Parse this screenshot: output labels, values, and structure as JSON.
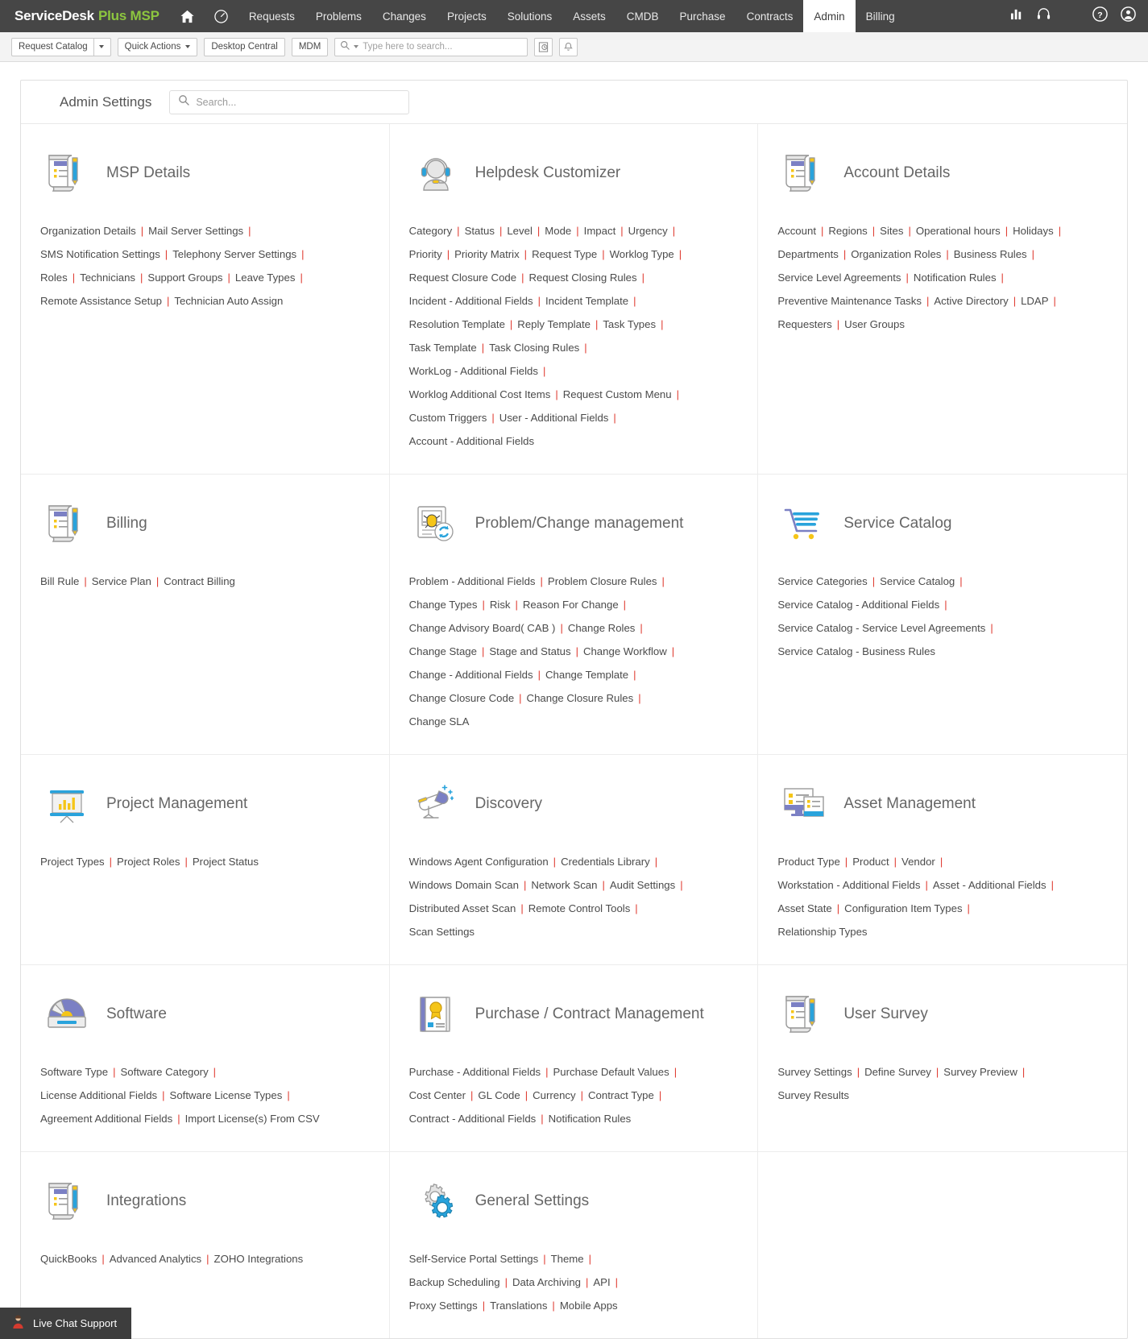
{
  "topnav": {
    "brand": {
      "part1": "ServiceDesk",
      "part2": "Plus MSP"
    },
    "home_icon": "home-icon",
    "dashboard_icon": "dashboard-icon",
    "items": [
      {
        "label": "Requests",
        "active": false
      },
      {
        "label": "Problems",
        "active": false
      },
      {
        "label": "Changes",
        "active": false
      },
      {
        "label": "Projects",
        "active": false
      },
      {
        "label": "Solutions",
        "active": false
      },
      {
        "label": "Assets",
        "active": false
      },
      {
        "label": "CMDB",
        "active": false
      },
      {
        "label": "Purchase",
        "active": false
      },
      {
        "label": "Contracts",
        "active": false
      },
      {
        "label": "Admin",
        "active": true
      },
      {
        "label": "Billing",
        "active": false
      }
    ],
    "reports_icon": "bar-chart-icon",
    "support_icon": "headset-icon",
    "help_icon": "question-circle-icon",
    "profile_icon": "user-circle-icon"
  },
  "toolbar": {
    "request_catalog": "Request Catalog",
    "quick_actions": "Quick Actions",
    "desktop_central": "Desktop Central",
    "mdm": "MDM",
    "search_placeholder": "Type here to search...",
    "search_value": "",
    "history_icon": "recent-history-icon",
    "alert_icon": "bell-icon"
  },
  "panel": {
    "title": "Admin Settings",
    "search_placeholder": "Search...",
    "search_value": "",
    "search_icon": "search-icon"
  },
  "sections": [
    {
      "id": "msp-details",
      "title": "MSP Details",
      "icon": "scroll-pen-icon",
      "links": [
        "Organization Details",
        "Mail Server Settings",
        "SMS Notification Settings",
        "Telephony Server Settings",
        "Roles",
        "Technicians",
        "Support Groups",
        "Leave Types",
        "Remote Assistance Setup",
        "Technician Auto Assign"
      ],
      "breaks": [
        2,
        4,
        8
      ]
    },
    {
      "id": "helpdesk-customizer",
      "title": "Helpdesk Customizer",
      "icon": "headset-person-icon",
      "links": [
        "Category",
        "Status",
        "Level",
        "Mode",
        "Impact",
        "Urgency",
        "Priority",
        "Priority Matrix",
        "Request Type",
        "Worklog Type",
        "Request Closure Code",
        "Request Closing Rules",
        "Incident - Additional Fields",
        "Incident Template",
        "Resolution Template",
        "Reply Template",
        "Task Types",
        "Task Template",
        "Task Closing Rules",
        "WorkLog - Additional Fields",
        "Worklog Additional Cost Items",
        "Request Custom Menu",
        "Custom Triggers",
        "User - Additional Fields",
        "Account - Additional Fields"
      ],
      "breaks": [
        6,
        10,
        12,
        14,
        17,
        19,
        20,
        22,
        24
      ]
    },
    {
      "id": "account-details",
      "title": "Account Details",
      "icon": "scroll-pen-icon",
      "links": [
        "Account",
        "Regions",
        "Sites",
        "Operational hours",
        "Holidays",
        "Departments",
        "Organization Roles",
        "Business Rules",
        "Service Level Agreements",
        "Notification Rules",
        "Preventive Maintenance Tasks",
        "Active Directory",
        "LDAP",
        "Requesters",
        "User Groups"
      ],
      "breaks": [
        5,
        8,
        10,
        13
      ]
    },
    {
      "id": "billing",
      "title": "Billing",
      "icon": "scroll-pen-icon",
      "links": [
        "Bill Rule",
        "Service Plan",
        "Contract Billing"
      ],
      "breaks": []
    },
    {
      "id": "problem-change-management",
      "title": "Problem/Change management",
      "icon": "bug-refresh-icon",
      "links": [
        "Problem - Additional Fields",
        "Problem Closure Rules",
        "Change Types",
        "Risk",
        "Reason For Change",
        "Change Advisory Board( CAB )",
        "Change Roles",
        "Change Stage",
        "Stage and Status",
        "Change Workflow",
        "Change - Additional Fields",
        "Change Template",
        "Change Closure Code",
        "Change Closure Rules",
        "Change SLA"
      ],
      "breaks": [
        2,
        5,
        7,
        10,
        12,
        14
      ]
    },
    {
      "id": "service-catalog",
      "title": "Service Catalog",
      "icon": "shopping-cart-icon",
      "links": [
        "Service Categories",
        "Service Catalog",
        "Service Catalog - Additional Fields",
        "Service Catalog - Service Level Agreements",
        "Service Catalog - Business Rules"
      ],
      "breaks": [
        2,
        3,
        4
      ]
    },
    {
      "id": "project-management",
      "title": "Project Management",
      "icon": "presentation-chart-icon",
      "links": [
        "Project Types",
        "Project Roles",
        "Project Status"
      ],
      "breaks": []
    },
    {
      "id": "discovery",
      "title": "Discovery",
      "icon": "telescope-icon",
      "links": [
        "Windows Agent Configuration",
        "Credentials Library",
        "Windows Domain Scan",
        "Network Scan",
        "Audit Settings",
        "Distributed Asset Scan",
        "Remote Control Tools",
        "Scan Settings"
      ],
      "breaks": [
        2,
        5,
        7
      ]
    },
    {
      "id": "asset-management",
      "title": "Asset Management",
      "icon": "monitor-devices-icon",
      "links": [
        "Product Type",
        "Product",
        "Vendor",
        "Workstation - Additional Fields",
        "Asset - Additional Fields",
        "Asset State",
        "Configuration Item Types",
        "Relationship Types"
      ],
      "breaks": [
        3,
        5,
        7
      ]
    },
    {
      "id": "software",
      "title": "Software",
      "icon": "cd-disc-icon",
      "links": [
        "Software Type",
        "Software Category",
        "License Additional Fields",
        "Software License Types",
        "Agreement Additional Fields",
        "Import License(s) From CSV"
      ],
      "breaks": [
        2,
        4
      ]
    },
    {
      "id": "purchase-contract-management",
      "title": "Purchase / Contract Management",
      "icon": "certificate-book-icon",
      "links": [
        "Purchase - Additional Fields",
        "Purchase Default Values",
        "Cost Center",
        "GL Code",
        "Currency",
        "Contract Type",
        "Contract - Additional Fields",
        "Notification Rules"
      ],
      "breaks": [
        2,
        6
      ]
    },
    {
      "id": "user-survey",
      "title": "User Survey",
      "icon": "scroll-pen-icon",
      "links": [
        "Survey Settings",
        "Define Survey",
        "Survey Preview",
        "Survey Results"
      ],
      "breaks": [
        3
      ]
    },
    {
      "id": "integrations",
      "title": "Integrations",
      "icon": "scroll-pen-icon",
      "links": [
        "QuickBooks",
        "Advanced Analytics",
        "ZOHO Integrations"
      ],
      "breaks": []
    },
    {
      "id": "general-settings",
      "title": "General Settings",
      "icon": "gears-icon",
      "links": [
        "Self-Service Portal Settings",
        "Theme",
        "Backup Scheduling",
        "Data Archiving",
        "API",
        "Proxy Settings",
        "Translations",
        "Mobile Apps"
      ],
      "breaks": [
        2,
        5
      ]
    }
  ],
  "livechat": {
    "label": "Live Chat Support",
    "icon": "agent-person-icon"
  },
  "colors": {
    "nav_bg": "#464646",
    "brand_green": "#8dc63f",
    "separator_red": "#e03a30",
    "icon_blue": "#29a3dc",
    "icon_purple": "#7b80c4",
    "icon_yellow": "#f5c518"
  }
}
